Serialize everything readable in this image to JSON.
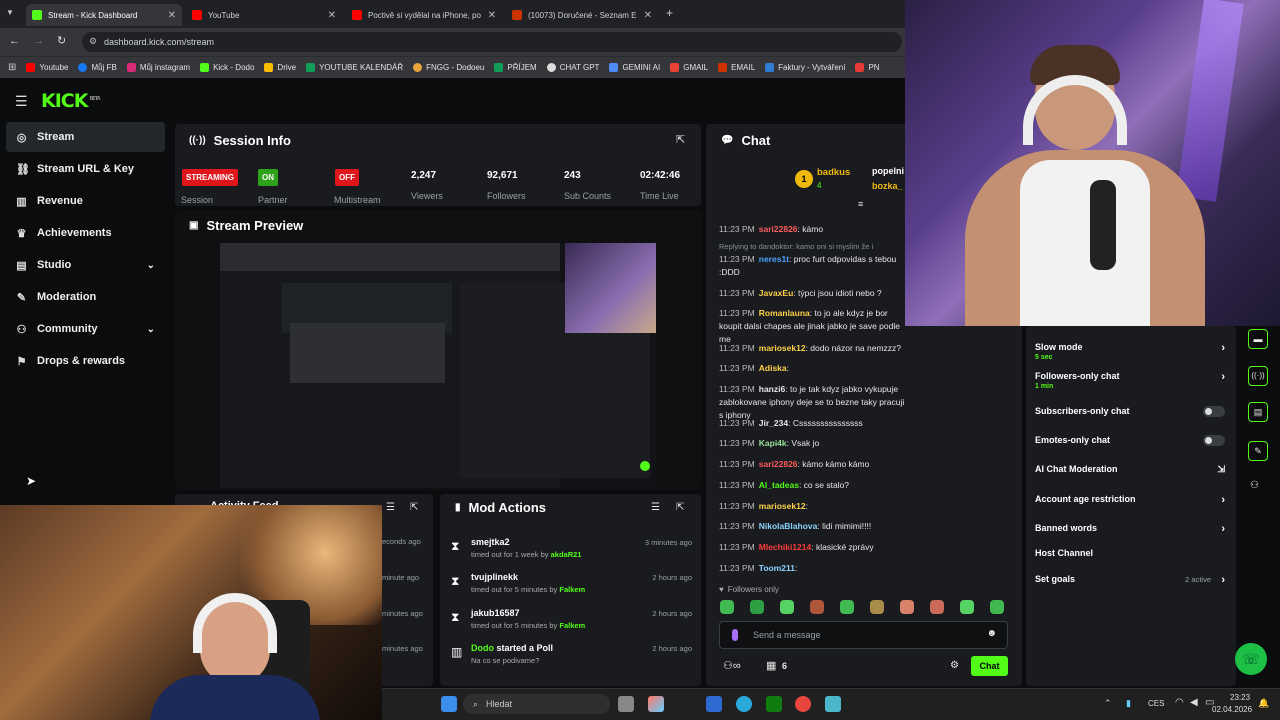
{
  "browser": {
    "tabs": [
      {
        "label": "Stream - Kick Dashboard",
        "active": true,
        "color": "#53fc18"
      },
      {
        "label": "YouTube",
        "active": false,
        "color": "#ff0000"
      },
      {
        "label": "Poctivě si vydělal na iPhone, po",
        "active": false,
        "color": "#ff0000"
      },
      {
        "label": "(10073) Doručené - Seznam E",
        "active": false,
        "color": "#cc3300"
      }
    ],
    "url": "dashboard.kick.com/stream",
    "bookmarks": [
      "Youtube",
      "Můj FB",
      "Můj instagram",
      "Kick - Dodo",
      "Drive",
      "YOUTUBE KALENDÁŘ",
      "FNGG - Dodoeu",
      "PŘÍJEM",
      "CHAT GPT",
      "GEMINI AI",
      "GMAIL",
      "EMAIL",
      "Faktury - Vytváření",
      "PN"
    ]
  },
  "logo": {
    "text": "KICK",
    "sup": "BETA"
  },
  "sidebar": {
    "items": [
      {
        "label": "Stream",
        "icon": "signal-icon"
      },
      {
        "label": "Stream URL & Key",
        "icon": "link-icon"
      },
      {
        "label": "Revenue",
        "icon": "chart-icon"
      },
      {
        "label": "Achievements",
        "icon": "trophy-icon"
      },
      {
        "label": "Studio",
        "icon": "studio-icon"
      },
      {
        "label": "Moderation",
        "icon": "wrench-icon"
      },
      {
        "label": "Community",
        "icon": "people-icon"
      },
      {
        "label": "Drops & rewards",
        "icon": "drops-icon"
      }
    ]
  },
  "session": {
    "title": "Session Info",
    "streaming_badge": "STREAMING",
    "session_label": "Session",
    "partner_badge": "ON",
    "partner_label": "Partner",
    "multistream_badge": "OFF",
    "multistream_label": "Multistream",
    "viewers": "2,247",
    "viewers_label": "Viewers",
    "followers": "92,671",
    "followers_label": "Followers",
    "subs": "243",
    "subs_label": "Sub Counts",
    "time": "02:42:46",
    "time_label": "Time Live"
  },
  "preview": {
    "title": "Stream Preview"
  },
  "activity": {
    "title": "Activity Feed",
    "times": [
      "econds ago",
      "minute ago",
      "minutes ago",
      "minutes ago"
    ]
  },
  "mod_actions": {
    "title": "Mod Actions",
    "items": [
      {
        "name": "smejtka2",
        "desc_pre": "timed out for 1 week by ",
        "by": "akdaR21",
        "ago": "3 minutes ago"
      },
      {
        "name": "tvujplinekk",
        "desc_pre": "timed out for 5 minutes by ",
        "by": "Falkem",
        "ago": "2 hours ago"
      },
      {
        "name": "jakub16587",
        "desc_pre": "timed out for 5 minutes by ",
        "by": "Falkem",
        "ago": "2 hours ago"
      },
      {
        "name": "Dodo",
        "name_suffix": " started a Poll",
        "desc": "Na co se podivame?",
        "ago": "2 hours ago"
      }
    ]
  },
  "chat": {
    "title": "Chat",
    "top_gifter": "badkus",
    "top_gifter_count": "4",
    "gifter2": "popelni",
    "gifter3": "bozka_",
    "reply_note": "Replying to dandoktor: kamo oni si myslim že i",
    "messages": [
      {
        "time": "11:23 PM",
        "user": "sari22826",
        "color": "#ff5c5c",
        "text": "kámo"
      },
      {
        "time": "11:23 PM",
        "user": "neres1t",
        "color": "#4aa3ff",
        "text": "proc furt odpovidas s tebou :DDD"
      },
      {
        "time": "11:23 PM",
        "user": "JavaxEu",
        "color": "#ffd24a",
        "text": "týpci jsou idioti nebo ?"
      },
      {
        "time": "11:23 PM",
        "user": "Romanlauna",
        "color": "#ffd24a",
        "text": "to jo ale kdyz je bor koupit dalsi chapes ale jinak jabko je save podle me"
      },
      {
        "time": "11:23 PM",
        "user": "mariosek12",
        "color": "#ffd24a",
        "text": "dodo názor na nemzzz?"
      },
      {
        "time": "11:23 PM",
        "user": "Adiska",
        "color": "#ffd24a",
        "text": ""
      },
      {
        "time": "11:23 PM",
        "user": "hanzi6",
        "color": "#e6e6e6",
        "text": "to je tak kdyz jabko vykupuje zablokovane iphony deje se to bezne taky pracuji s iphony"
      },
      {
        "time": "11:23 PM",
        "user": "Jir_234",
        "color": "#e6e6e6",
        "text": "Csssssssssssssss"
      },
      {
        "time": "11:23 PM",
        "user": "Kapi4k",
        "color": "#9be29b",
        "text": "Vsak jo"
      },
      {
        "time": "11:23 PM",
        "user": "sari22826",
        "color": "#ff5c5c",
        "text": "kámo kámo kámo"
      },
      {
        "time": "11:23 PM",
        "user": "Al_tadeas",
        "color": "#53fc18",
        "text": "co se stalo?"
      },
      {
        "time": "11:23 PM",
        "user": "mariosek12",
        "color": "#ffd24a",
        "text": ""
      },
      {
        "time": "11:23 PM",
        "user": "NikolaBlahova",
        "color": "#8ad4ff",
        "text": "lidi mimimi!!!!"
      },
      {
        "time": "11:23 PM",
        "user": "Mlechiki1214",
        "color": "#ff3b3b",
        "text": "klasické zprávy"
      },
      {
        "time": "11:23 PM",
        "user": "Toom211",
        "color": "#8ad4ff",
        "text": ""
      }
    ],
    "followers_only": "Followers only",
    "placeholder": "Send a message",
    "viewer_count": "6",
    "chat_button": "Chat"
  },
  "channel_actions": {
    "items": [
      {
        "label": "Slow mode",
        "sub": "5 sec",
        "control": "chevron"
      },
      {
        "label": "Followers-only chat",
        "sub": "1 min",
        "control": "chevron"
      },
      {
        "label": "Subscribers-only chat",
        "control": "toggle"
      },
      {
        "label": "Emotes-only chat",
        "control": "toggle"
      },
      {
        "label": "AI Chat Moderation",
        "control": "external"
      },
      {
        "label": "Account age restriction",
        "control": "chevron"
      },
      {
        "label": "Banned words",
        "control": "chevron"
      },
      {
        "label": "Host Channel",
        "control": "none"
      },
      {
        "label": "Set goals",
        "extra": "2 active",
        "control": "chevron"
      }
    ]
  },
  "taskbar": {
    "search_placeholder": "Hledat",
    "lang": "CES",
    "time": "23:23",
    "date": "02.04.2026"
  }
}
